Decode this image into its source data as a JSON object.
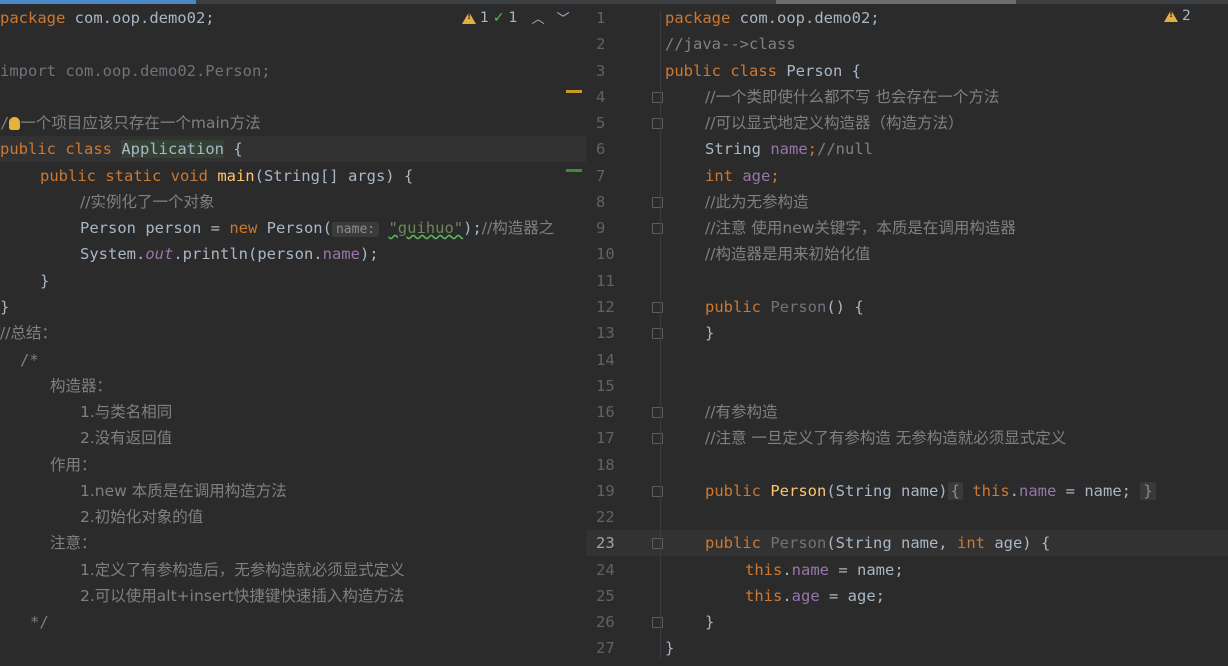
{
  "left_editor": {
    "inspections": {
      "warnings": "1",
      "ok": "1"
    },
    "lines": {
      "l1": {
        "kw": "package",
        "rest": " com.oop.demo02;"
      },
      "l3": {
        "kw": "import",
        "rest": " com.oop.demo02.Person;"
      },
      "l5": {
        "pre": "/",
        "text": "一个项目应该只存在一个main方法"
      },
      "l6": {
        "kw": "public class ",
        "name": "Application",
        "rest": " {"
      },
      "l7": {
        "kw": "public static void ",
        "fn": "main",
        "rest": "(String[] args) {"
      },
      "l8": {
        "text": "//实例化了一个对象"
      },
      "l9": {
        "a": "Person person = ",
        "kw": "new",
        "b": " Person(",
        "hint": "name:",
        "str": "\"guihuo\"",
        "c": ");",
        "cm": "//构造器之"
      },
      "l10": {
        "a": "System.",
        "stat": "out",
        "b": ".println(person.",
        "fld": "name",
        "c": ");"
      },
      "l11": {
        "text": "}"
      },
      "l12": {
        "text": "}"
      },
      "l13": {
        "text": "//总结："
      },
      "l14": {
        "text": "/*"
      },
      "l15": {
        "text": "构造器："
      },
      "l16": {
        "text": "1.与类名相同"
      },
      "l17": {
        "text": "2.没有返回值"
      },
      "l18": {
        "text": "作用："
      },
      "l19": {
        "text": "1.new 本质是在调用构造方法"
      },
      "l20": {
        "text": "2.初始化对象的值"
      },
      "l21": {
        "text": "注意："
      },
      "l22": {
        "text": "1.定义了有参构造后，无参构造就必须显式定义"
      },
      "l23": {
        "text": "2.可以使用alt+insert快捷键快速插入构造方法"
      },
      "l24": {
        "text": "*/"
      }
    }
  },
  "right_editor": {
    "inspections": {
      "warnings": "2"
    },
    "line_numbers": [
      "1",
      "2",
      "3",
      "4",
      "5",
      "6",
      "7",
      "8",
      "9",
      "10",
      "11",
      "12",
      "13",
      "14",
      "15",
      "16",
      "17",
      "18",
      "19",
      "22",
      "23",
      "24",
      "25",
      "26",
      "27"
    ],
    "current_line": "23",
    "lines": {
      "r1": {
        "kw": "package",
        "rest": " com.oop.demo02;"
      },
      "r2": {
        "text": "//java-->class"
      },
      "r3": {
        "kw": "public class ",
        "rest": "Person {"
      },
      "r4": {
        "text": "//一个类即使什么都不写 也会存在一个方法"
      },
      "r5": {
        "text": "//可以显式地定义构造器（构造方法）"
      },
      "r6": {
        "a": "String ",
        "fld": "name",
        "b": ";",
        "cm": "//null"
      },
      "r7": {
        "kw": "int ",
        "fld": "age",
        "b": ";"
      },
      "r8": {
        "text": "//此为无参构造"
      },
      "r9": {
        "text": "//注意 使用new关键字，本质是在调用构造器"
      },
      "r10": {
        "text": "//构造器是用来初始化值"
      },
      "r12": {
        "kw": "public ",
        "fn": "Person",
        "rest": "() {"
      },
      "r13": {
        "text": "}"
      },
      "r16": {
        "text": "//有参构造"
      },
      "r17": {
        "text": "//注意 一旦定义了有参构造 无参构造就必须显式定义"
      },
      "r19": {
        "kw": "public ",
        "fn": "Person",
        "a": "(String name)",
        "fold_open": "{",
        "kw2": "this",
        "dot": ".",
        "fld": "name",
        "b": " = name;",
        "fold_close": "}"
      },
      "r23": {
        "kw": "public ",
        "fn": "Person",
        "a": "(String name, ",
        "kw2": "int",
        "b": " age) {"
      },
      "r24": {
        "kw": "this",
        "dot": ".",
        "fld": "name",
        "b": " = name;"
      },
      "r25": {
        "kw": "this",
        "dot": ".",
        "fld": "age",
        "b": " = age;"
      },
      "r26": {
        "text": "}"
      },
      "r27": {
        "text": "}"
      }
    }
  },
  "colors": {
    "keyword": "#cc7832",
    "comment": "#808080",
    "string": "#6a8759",
    "field": "#9876aa",
    "method": "#ffc66d",
    "warning": "#e0b040"
  }
}
